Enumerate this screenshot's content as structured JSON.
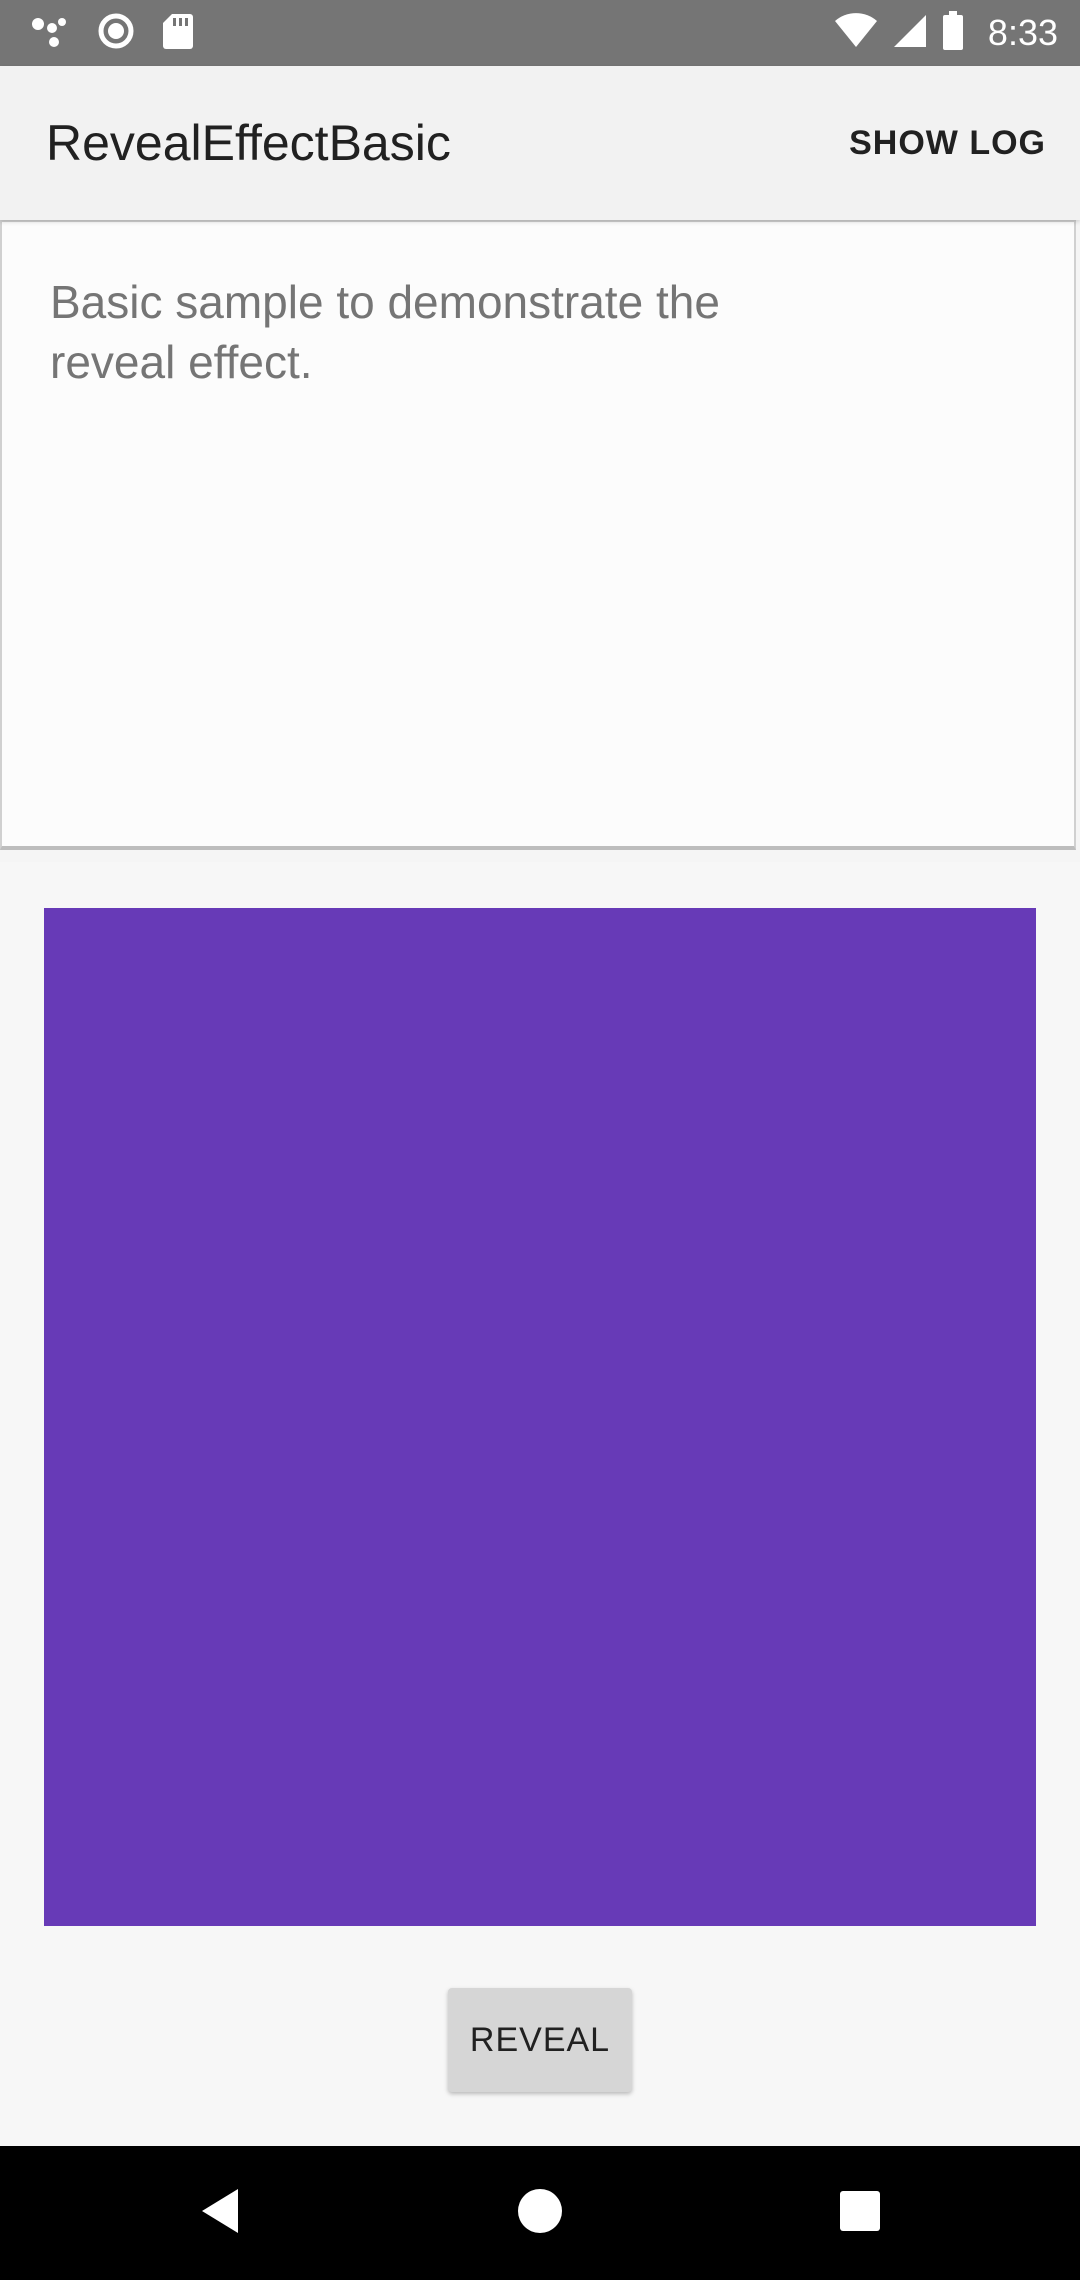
{
  "status_bar": {
    "time": "8:33",
    "icons_left": [
      "notification-dots-icon",
      "circle-status-icon",
      "sd-card-icon"
    ],
    "icons_right": [
      "wifi-icon",
      "cell-signal-icon",
      "battery-icon"
    ]
  },
  "app_bar": {
    "title": "RevealEffectBasic",
    "action_label": "SHOW LOG"
  },
  "intro": {
    "text": "Basic sample to demonstrate the reveal effect."
  },
  "content": {
    "reveal_color": "#673ab7",
    "button_label": "REVEAL"
  },
  "nav_bar": {
    "icons": [
      "back-icon",
      "home-icon",
      "recents-icon"
    ]
  }
}
